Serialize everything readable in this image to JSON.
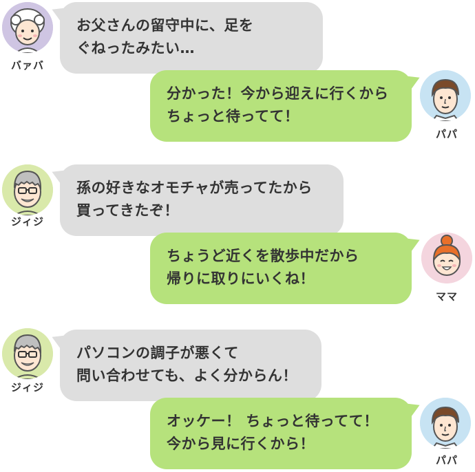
{
  "colors": {
    "incoming_bubble": "#dedede",
    "outgoing_bubble": "#b6e27c",
    "text": "#333333",
    "grandma_avatar_bg": "#cfc5e3",
    "papa_avatar_bg": "#c7e3f3",
    "grandpa_avatar_bg": "#d9e9aa",
    "mama_avatar_bg": "#f4d5de"
  },
  "messages": [
    {
      "speaker": "バァバ",
      "avatar_icon": "grandma-avatar-icon",
      "side": "left",
      "lines": [
        "お父さんの留守中に、足を",
        "ぐねったみたい…"
      ]
    },
    {
      "speaker": "パパ",
      "avatar_icon": "papa-avatar-icon",
      "side": "right",
      "lines": [
        "分かった！今から迎えに行くから",
        "ちょっと待ってて！"
      ]
    },
    {
      "speaker": "ジィジ",
      "avatar_icon": "grandpa-avatar-icon",
      "side": "left",
      "lines": [
        "孫の好きなオモチャが売ってたから",
        "買ってきたぞ！"
      ]
    },
    {
      "speaker": "ママ",
      "avatar_icon": "mama-avatar-icon",
      "side": "right",
      "lines": [
        "ちょうど近くを散歩中だから",
        "帰りに取りにいくね！"
      ]
    },
    {
      "speaker": "ジィジ",
      "avatar_icon": "grandpa-avatar-icon",
      "side": "left",
      "lines": [
        "パソコンの調子が悪くて",
        "問い合わせても、よく分からん！"
      ]
    },
    {
      "speaker": "パパ",
      "avatar_icon": "papa-avatar-icon",
      "side": "right",
      "lines": [
        "オッケー！ ちょっと待ってて！",
        "今から見に行くから！"
      ]
    }
  ]
}
